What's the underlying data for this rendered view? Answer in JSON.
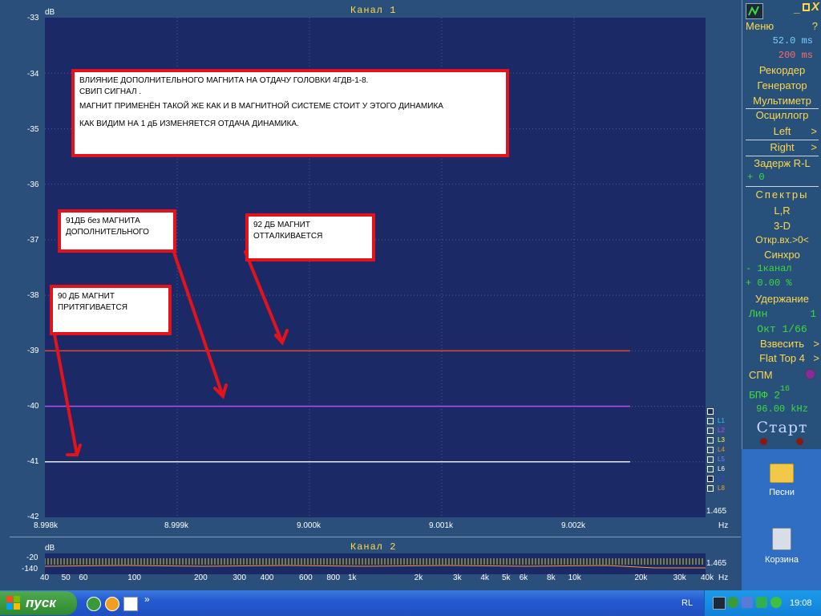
{
  "channel1": {
    "title": "Канал 1",
    "y_unit": "dB",
    "y_ticks": [
      "-33",
      "-34",
      "-35",
      "-36",
      "-37",
      "-38",
      "-39",
      "-40",
      "-41",
      "-42"
    ],
    "x_ticks": [
      "8.998k",
      "8.999k",
      "9.000k",
      "9.001k",
      "9.002k"
    ],
    "x_unit": "Hz",
    "scale_value": "1.465",
    "chart_data": {
      "type": "line",
      "ylim": [
        -42,
        -33
      ],
      "series": [
        {
          "color": "#e0452e",
          "y": -39
        },
        {
          "color": "#b64ff0",
          "y": -40
        },
        {
          "color": "#e8e8ff",
          "y": -41
        }
      ]
    }
  },
  "annotations": {
    "main": {
      "line1": "ВЛИЯНИЕ ДОПОЛНИТЕЛЬНОГО МАГНИТА НА ОТДАЧУ ГОЛОВКИ 4ГДВ-1-8.",
      "line2": "СВИП  СИГНАЛ .",
      "line3": "МАГНИТ ПРИМЕНЁН ТАКОЙ ЖЕ  КАК  И  В МАГНИТНОЙ  СИСТЕМЕ  СТОИТ  У  ЭТОГО  ДИНАМИКА",
      "line4": "КАК  ВИДИМ  НА  1 дБ  ИЗМЕНЯЕТСЯ  ОТДАЧА  ДИНАМИКА."
    },
    "box91": {
      "line1": "91ДБ  без  МАГНИТА",
      "line2": "ДОПОЛНИТЕЛЬНОГО"
    },
    "box92": {
      "line1": "92 ДБ  МАГНИТ",
      "line2": " ОТТАЛКИВАЕТСЯ"
    },
    "box90": {
      "line1": " 90 ДБ  МАГНИТ",
      "line2": "ПРИТЯГИВАЕТСЯ"
    }
  },
  "legend": [
    {
      "label": "",
      "color": "#3a3aff"
    },
    {
      "label": "L1",
      "color": "#2ec8ff"
    },
    {
      "label": "L2",
      "color": "#d040ff"
    },
    {
      "label": "L3",
      "color": "#ffff40"
    },
    {
      "label": "L4",
      "color": "#ff8a2a"
    },
    {
      "label": "L5",
      "color": "#8080ff"
    },
    {
      "label": "L6",
      "color": "#ffffff"
    },
    {
      "label": "L7",
      "color": "#3a3aff"
    },
    {
      "label": "L8",
      "color": "#ff9a30"
    }
  ],
  "channel2": {
    "title": "Канал 2",
    "y_unit": "dB",
    "y_top": "-20",
    "y_bottom": "-140",
    "scale_value": "1.465",
    "x_unit": "Hz",
    "x_ticks": [
      "40",
      "50",
      "60",
      "100",
      "200",
      "300",
      "400",
      "600",
      "800",
      "1k",
      "2k",
      "3k",
      "4k",
      "5k",
      "6k",
      "8k",
      "10k",
      "20k",
      "30k",
      "40k"
    ]
  },
  "sidebar": {
    "menu": "Меню",
    "help": "?",
    "time1": "52.0 ms",
    "time2": "200  ms",
    "recorder": "Рекордер",
    "generator": "Генератор",
    "multimeter": "Мультиметр",
    "oscilloscope": "Осциллогр",
    "left": "Left",
    "right": "Right",
    "delay": "Задерж R-L",
    "delay_val": "+     0",
    "spectra": "Спектры",
    "lr": "L,R",
    "threed": "3-D",
    "open_input": "Откр.вх.>0<",
    "sync": "Синхро",
    "sync_ch": "- 1канал",
    "sync_pct": "+ 0.00 %",
    "hold": "Удержание",
    "lin": "Лин",
    "lin_val": "1",
    "oct": "Окт 1/66",
    "weigh": "Взвесить",
    "flattop": "Flat Top 4",
    "spm": "СПМ",
    "fft": "БПФ 2",
    "fft_exp": "16",
    "rate": "96.00 kHz",
    "start": "Старт"
  },
  "desktop": {
    "songs": "Песни",
    "trash": "Корзина"
  },
  "taskbar": {
    "start": "пуск",
    "lang": "RL",
    "clock": "19:08"
  }
}
